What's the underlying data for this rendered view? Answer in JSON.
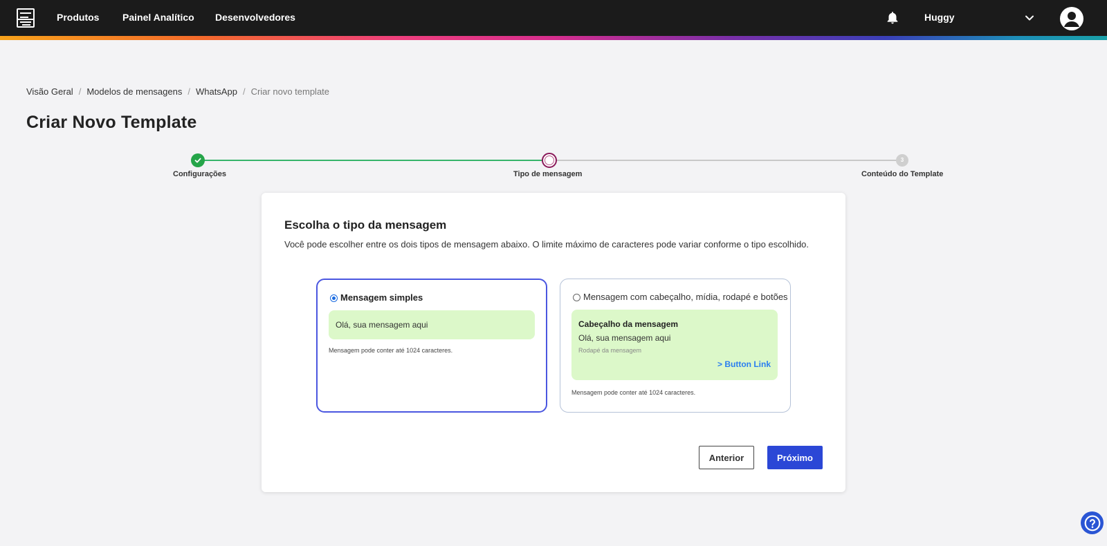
{
  "nav": {
    "items": [
      {
        "label": "Produtos"
      },
      {
        "label": "Painel Analítico"
      },
      {
        "label": "Desenvolvedores"
      }
    ],
    "user_name": "Huggy",
    "icons": {
      "logo": "zenvia-logo",
      "notifications": "bell-icon",
      "menu": "chevron-down-icon",
      "avatar": "user-avatar-icon"
    }
  },
  "breadcrumb": {
    "items": [
      "Visão Geral",
      "Modelos de mensagens",
      "WhatsApp",
      "Criar novo template"
    ],
    "separator": "/"
  },
  "page": {
    "title": "Criar Novo Template"
  },
  "stepper": {
    "steps": [
      {
        "label": "Configurações",
        "state": "done"
      },
      {
        "label": "Tipo de mensagem",
        "state": "active"
      },
      {
        "label": "Conteúdo do Template",
        "state": "todo",
        "number": "3"
      }
    ]
  },
  "card": {
    "title": "Escolha o tipo da mensagem",
    "description": "Você pode escolher entre os dois tipos de mensagem abaixo. O limite máximo de caracteres pode variar conforme o tipo escolhido.",
    "options": [
      {
        "label": "Mensagem simples",
        "selected": true,
        "preview_body": "Olá, sua mensagem aqui",
        "hint": "Mensagem pode conter até 1024 caracteres."
      },
      {
        "label": "Mensagem com cabeçalho, mídia, rodapé e botões",
        "selected": false,
        "preview_header": "Cabeçalho da mensagem",
        "preview_body": "Olá, sua mensagem aqui",
        "preview_footer": "Rodapé da mensagem",
        "preview_button": "> Button Link",
        "hint": "Mensagem pode conter até 1024 caracteres."
      }
    ],
    "buttons": {
      "previous": "Anterior",
      "next": "Próximo"
    }
  },
  "colors": {
    "accent": "#2b47d6",
    "selected_border": "#4a56e0",
    "step_done": "#25a549",
    "bubble": "#dcf8c9",
    "link": "#2a7ef0"
  },
  "help": {
    "icon": "help-icon"
  }
}
